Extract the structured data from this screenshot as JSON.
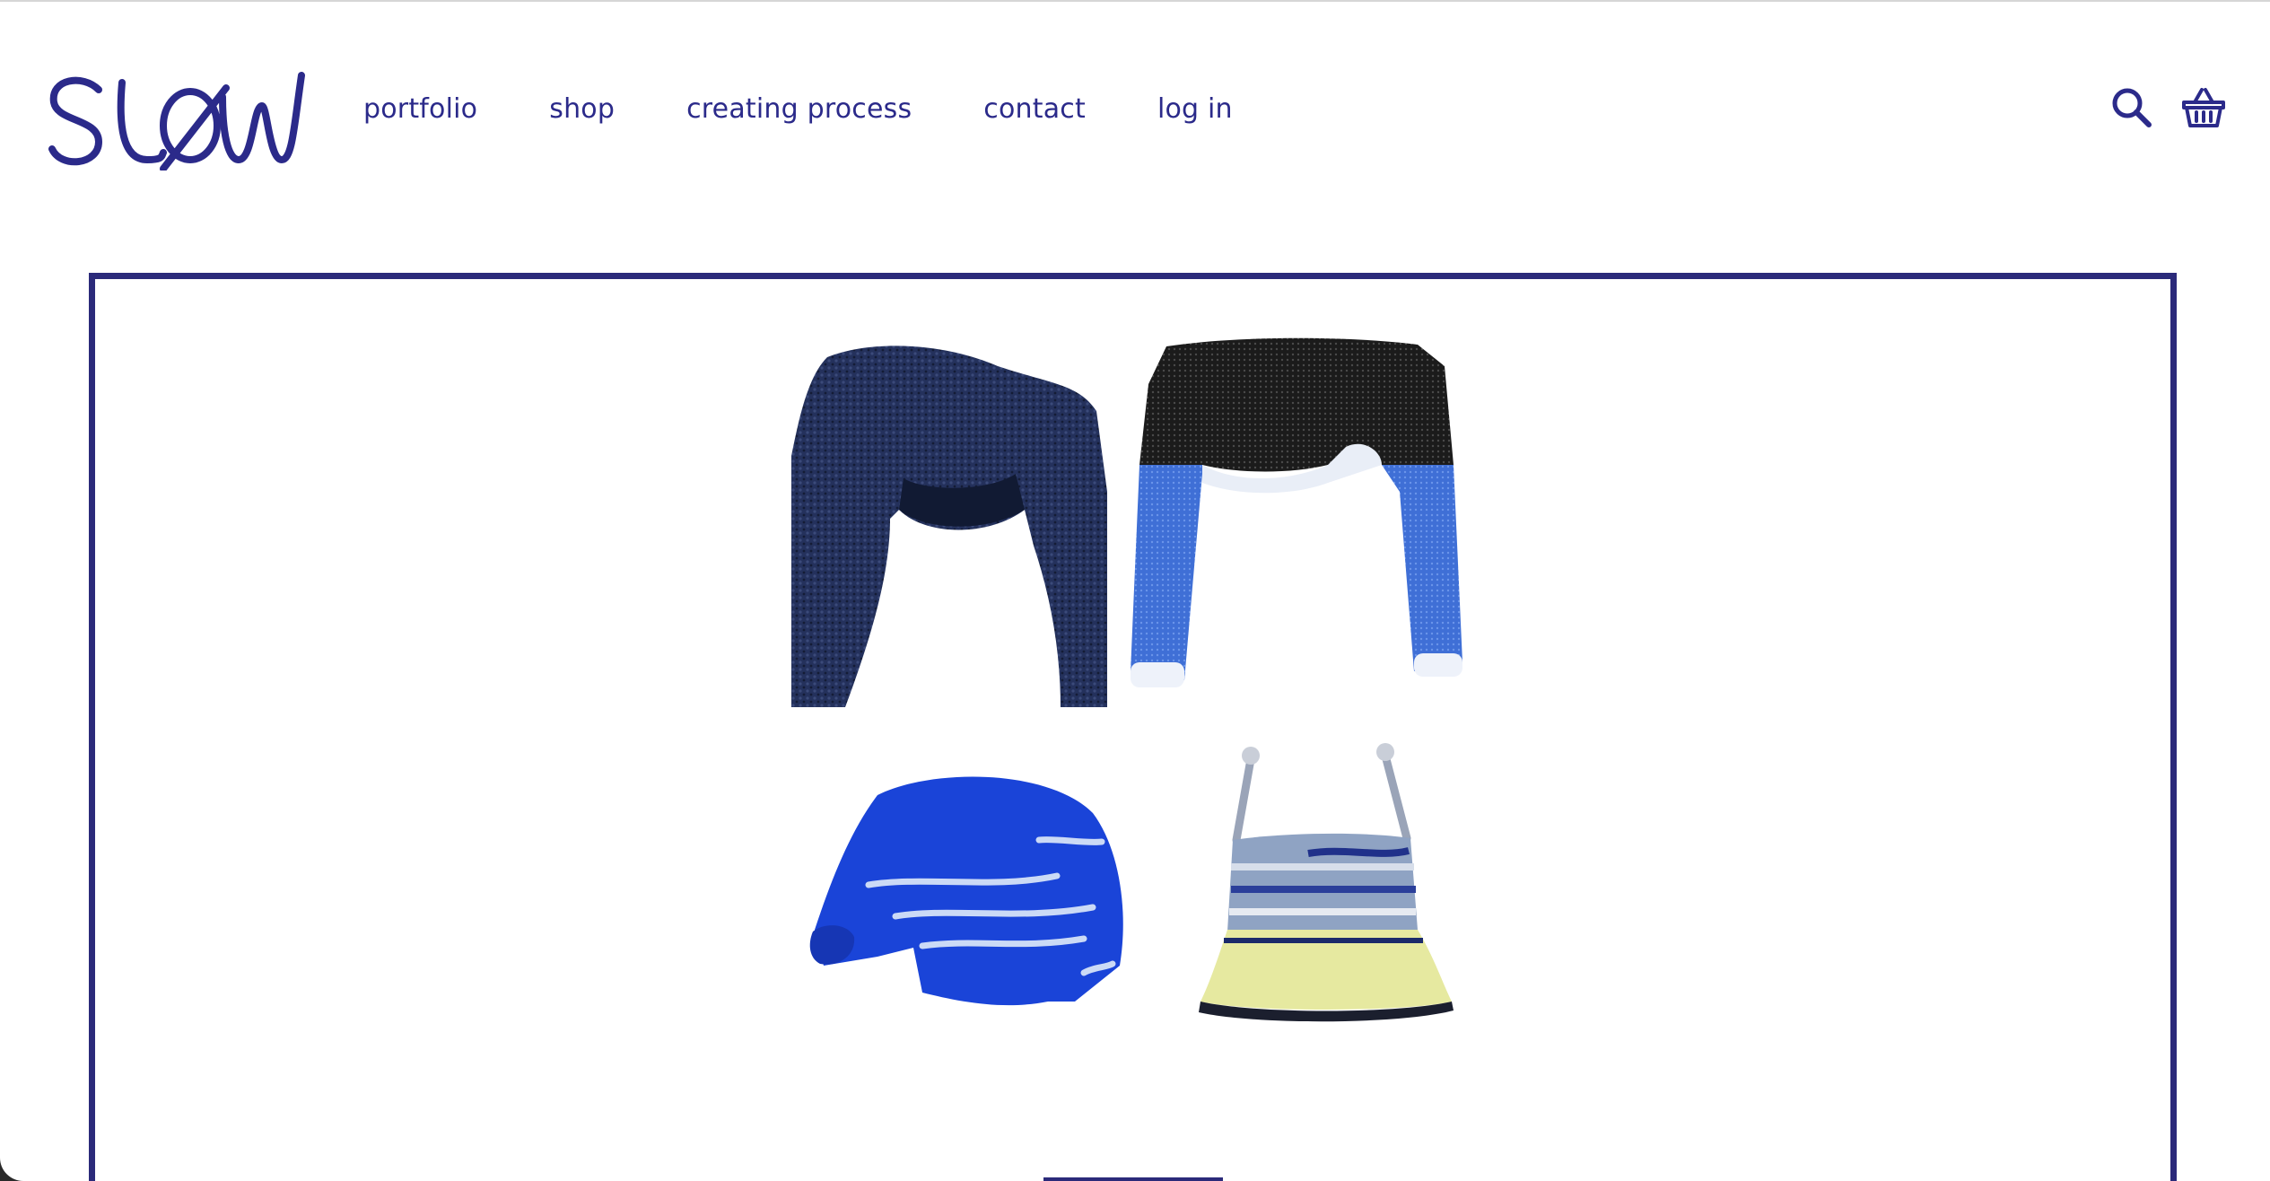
{
  "brand": {
    "logo_text": "SLOW",
    "color": "#2b2a8a"
  },
  "nav": {
    "items": [
      {
        "label": "portfolio"
      },
      {
        "label": "shop"
      },
      {
        "label": "creating process"
      },
      {
        "label": "contact"
      },
      {
        "label": "log in"
      }
    ]
  },
  "header_icons": {
    "search": "search-icon",
    "cart": "basket-icon"
  },
  "gallery": {
    "items": [
      {
        "name": "dark-navy-knit-shrug"
      },
      {
        "name": "black-and-blue-knit-shrug"
      },
      {
        "name": "cobalt-striped-sweater"
      },
      {
        "name": "striped-knit-cami"
      }
    ]
  },
  "colors": {
    "accent": "#2b2a8a",
    "frame": "#2b2a7a",
    "background": "#ffffff"
  }
}
